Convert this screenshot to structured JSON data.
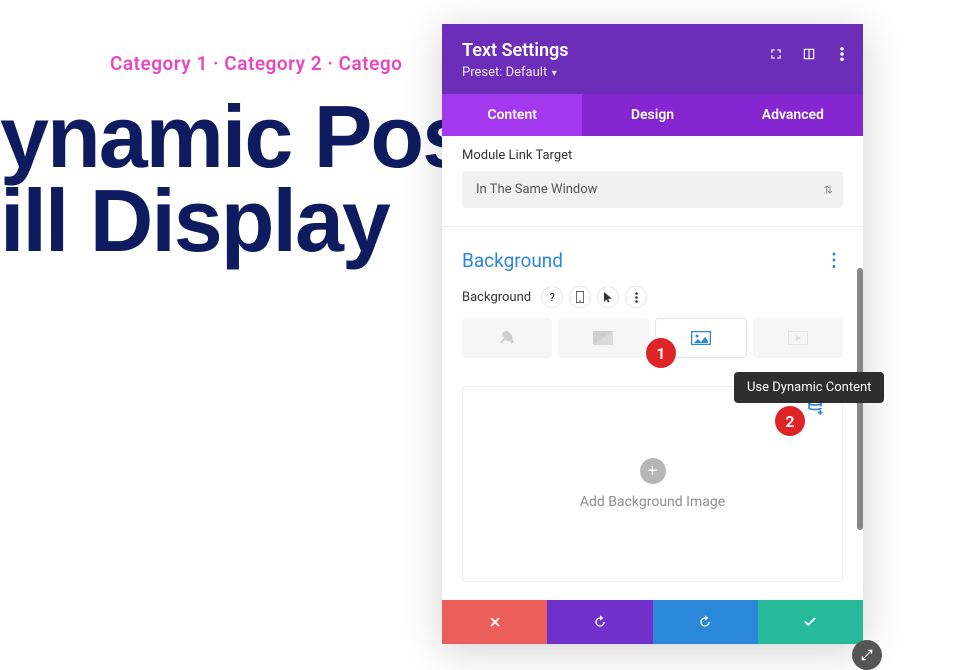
{
  "page": {
    "categories": "Category 1 · Category 2 · Catego",
    "title_line1": "ynamic Post",
    "title_line2": "ill Display"
  },
  "panel": {
    "title": "Text Settings",
    "preset_prefix": "Preset: ",
    "preset_value": "Default"
  },
  "tabs": {
    "content": "Content",
    "design": "Design",
    "advanced": "Advanced"
  },
  "link_section": {
    "label": "Module Link Target",
    "value": "In The Same Window"
  },
  "background": {
    "title": "Background",
    "row_label": "Background",
    "help": "?",
    "dropzone_label": "Add Background Image"
  },
  "tooltip": "Use Dynamic Content",
  "badges": {
    "one": "1",
    "two": "2"
  }
}
